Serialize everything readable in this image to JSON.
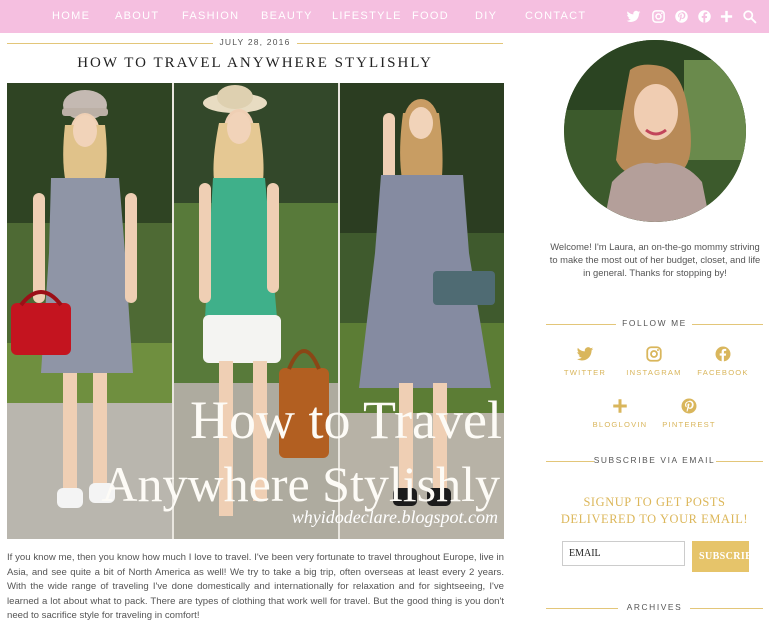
{
  "nav": {
    "items": [
      "HOME",
      "ABOUT",
      "FASHION",
      "BEAUTY",
      "LIFESTYLE",
      "FOOD",
      "DIY",
      "CONTACT"
    ],
    "icons": [
      "twitter-icon",
      "instagram-icon",
      "pinterest-icon",
      "facebook-icon",
      "plus-icon",
      "search-icon"
    ],
    "background": "#f5bfe0"
  },
  "post": {
    "date": "JULY 28, 2016",
    "title": "HOW TO TRAVEL ANYWHERE STYLISHLY",
    "image_overlay": {
      "line1": "How to Travel",
      "line2": "Anywhere Stylishly",
      "watermark": "whyidodeclare.blogspot.com"
    },
    "body": "If you know me, then you know how much I love to travel. I've been very fortunate to travel throughout Europe, live in Asia, and see quite a bit of North America as well! We try to take a big trip, often overseas at least every 2 years. With the wide range of traveling I've done domestically and internationally for relaxation and for sightseeing, I've learned a lot about what to pack. There are types of clothing that work well for travel. But the good thing is you don't need to sacrifice style for traveling in comfort!"
  },
  "sidebar": {
    "welcome": "Welcome! I'm Laura, an on-the-go mommy striving to make the most out of her budget, closet, and life in general. Thanks for stopping by!",
    "follow_title": "FOLLOW ME",
    "social": [
      {
        "label": "TWITTER",
        "icon": "twitter-icon"
      },
      {
        "label": "INSTAGRAM",
        "icon": "instagram-icon"
      },
      {
        "label": "FACEBOOK",
        "icon": "facebook-icon"
      },
      {
        "label": "BLOGLOVIN",
        "icon": "plus-icon"
      },
      {
        "label": "PINTEREST",
        "icon": "pinterest-icon"
      }
    ],
    "subscribe_title": "SUBSCRIBE VIA EMAIL",
    "signup_line1": "SIGNUP TO GET POSTS",
    "signup_line2": "DELIVERED TO YOUR EMAIL!",
    "email_placeholder": "EMAIL",
    "subscribe_button": "SUBSCRIBE",
    "archives_title": "ARCHIVES"
  },
  "colors": {
    "accent_gold": "#e3c679",
    "nav_pink": "#f5bfe0"
  }
}
